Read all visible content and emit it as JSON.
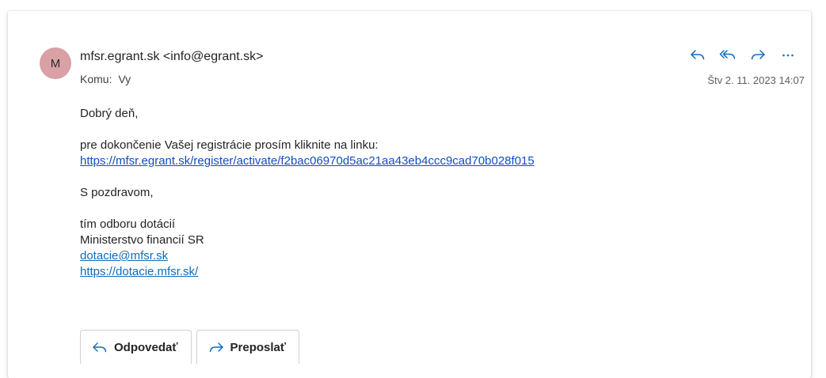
{
  "sender": {
    "avatar_initial": "M",
    "avatar_color": "#d9a0a6",
    "display": "mfsr.egrant.sk <info@egrant.sk>"
  },
  "recipient": {
    "label": "Komu:",
    "value": "Vy"
  },
  "date": "Štv 2. 11. 2023 14:07",
  "actions": [
    {
      "name": "reply",
      "icon": "reply-icon"
    },
    {
      "name": "reply-all",
      "icon": "reply-all-icon"
    },
    {
      "name": "forward",
      "icon": "forward-icon"
    },
    {
      "name": "more",
      "icon": "more-icon"
    }
  ],
  "accent_color": "#0f6cbd",
  "body": {
    "greeting": "Dobrý deň,",
    "intro": "pre dokončenie Vašej registrácie prosím kliknite na linku:",
    "activation_link": "https://mfsr.egrant.sk/register/activate/f2bac06970d5ac21aa43eb4ccc9cad70b028f015",
    "closing": "S pozdravom,",
    "signature": {
      "line1": "tím odboru dotácií",
      "line2": "Ministerstvo financií SR",
      "email": "dotacie@mfsr.sk",
      "website": "https://dotacie.mfsr.sk/"
    }
  },
  "reply_bar": {
    "reply_label": "Odpovedať",
    "forward_label": "Preposlať"
  }
}
